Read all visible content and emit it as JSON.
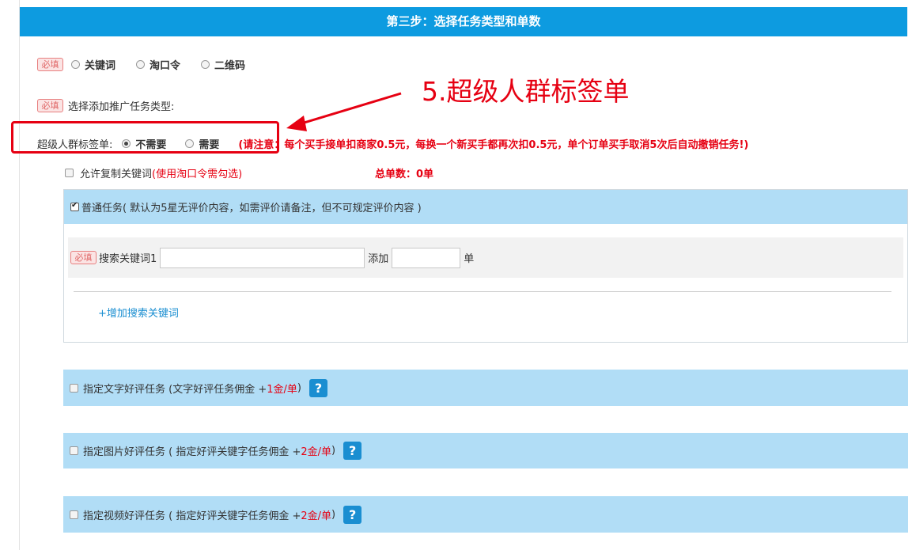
{
  "header": {
    "title": "第三步：选择任务类型和单数"
  },
  "required_badge": "必填",
  "entry_type": {
    "options": [
      "关键词",
      "淘口令",
      "二维码"
    ]
  },
  "promo_type_label": "选择添加推广任务类型:",
  "crowd_tag": {
    "label": "超级人群标签单:",
    "options": [
      "不需要",
      "需要"
    ],
    "selected": "不需要",
    "note": "(请注意：每个买手接单扣商家0.5元，每换一个新买手都再次扣0.5元，单个订单买手取消5次后自动撤销任务!)"
  },
  "annotation": {
    "text": "5.超级人群标签单"
  },
  "copy_keyword": {
    "label": "允许复制关键词",
    "hint": "(使用淘口令需勾选)"
  },
  "total_orders": {
    "label": "总单数：0单"
  },
  "normal_task": {
    "label": "普通任务( 默认为5星无评价内容，如需评价请备注，但不可规定评价内容 )",
    "search_keyword_label": "搜索关键词1",
    "search_keyword_value": "",
    "add_label": "添加",
    "count_value": "",
    "unit_label": "单",
    "add_keyword_link": "+增加搜索关键词"
  },
  "options": [
    {
      "label": "指定文字好评任务 (文字好评任务佣金 + ",
      "amount": "1金/单",
      "suffix": " )"
    },
    {
      "label": "指定图片好评任务 ( 指定好评关键字任务佣金 + ",
      "amount": "2金/单",
      "suffix": " )"
    },
    {
      "label": "指定视频好评任务 ( 指定好评关键字任务佣金 + ",
      "amount": "2金/单",
      "suffix": " )"
    }
  ],
  "help_symbol": "?",
  "colors": {
    "header_blue": "#0d9be0",
    "strip_blue": "#b1ddf6",
    "accent_red": "#e60012",
    "link_blue": "#1a8ed1"
  }
}
